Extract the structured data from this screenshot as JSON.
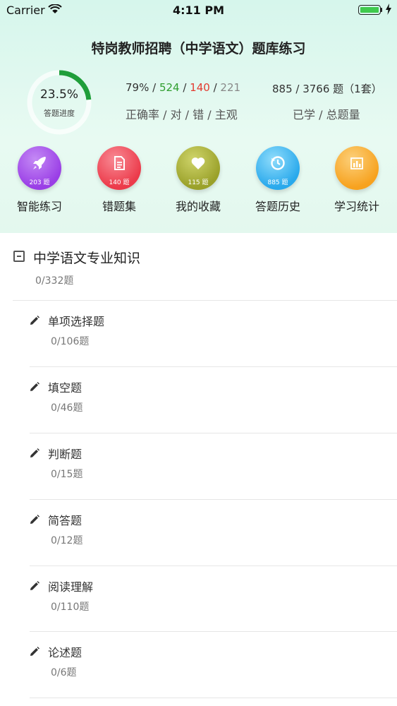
{
  "status_bar": {
    "carrier": "Carrier",
    "time": "4:11 PM",
    "battery_color": "#3fca4d"
  },
  "header": {
    "title": "特岗教师招聘（中学语文）题库练习",
    "progress": {
      "percent_text": "23.5%",
      "value": 0.235,
      "label": "答题进度",
      "ring_color": "#1f9e3a"
    },
    "accuracy": {
      "rate": "79%",
      "correct": "524",
      "wrong": "140",
      "subjective": "221",
      "caption": "正确率 / 对 / 错 / 主观",
      "correct_color": "#2f9e2f",
      "wrong_color": "#e33a2f"
    },
    "learned": {
      "text": "885 / 3766 题（1套）",
      "caption": "已学 / 总题量"
    }
  },
  "tools": [
    {
      "label": "智能练习",
      "badge": "203 题",
      "icon": "rocket-icon",
      "color": "#9a3ee6"
    },
    {
      "label": "错题集",
      "badge": "140 题",
      "icon": "document-icon",
      "color": "#ec3a4a"
    },
    {
      "label": "我的收藏",
      "badge": "115 题",
      "icon": "heart-icon",
      "color": "#9aa12a"
    },
    {
      "label": "答题历史",
      "badge": "885 题",
      "icon": "history-icon",
      "color": "#29a9ec"
    },
    {
      "label": "学习统计",
      "badge": "",
      "icon": "bar-chart-icon",
      "color": "#f7a21f"
    }
  ],
  "chapter": {
    "title": "中学语文专业知识",
    "count": "0/332题",
    "sections": [
      {
        "title": "单项选择题",
        "count": "0/106题"
      },
      {
        "title": "填空题",
        "count": "0/46题"
      },
      {
        "title": "判断题",
        "count": "0/15题"
      },
      {
        "title": "简答题",
        "count": "0/12题"
      },
      {
        "title": "阅读理解",
        "count": "0/110题"
      },
      {
        "title": "论述题",
        "count": "0/6题"
      }
    ]
  }
}
